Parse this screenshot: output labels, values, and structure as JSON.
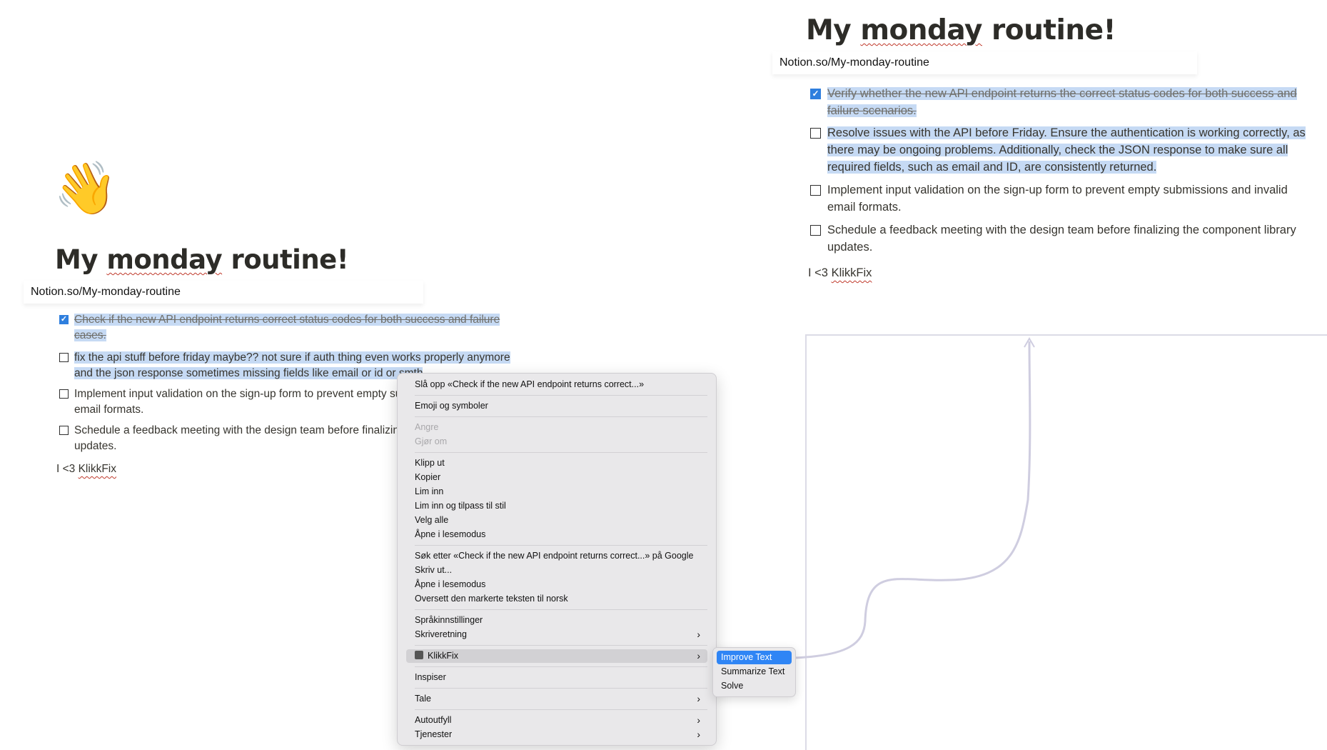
{
  "left_page": {
    "emoji": "👋",
    "title_prefix": "My ",
    "title_misspelled": "monday",
    "title_suffix": " routine!",
    "url": "Notion.so/My-monday-routine",
    "tasks": [
      {
        "checked": true,
        "lines": [
          "Check if the new API endpoint returns correct status codes for both success and failure",
          "cases."
        ]
      },
      {
        "checked": false,
        "lines": [
          "fix the api stuff before friday maybe?? not sure if auth thing even works properly anymore",
          "and the json response sometimes missing fields like email or id or smth"
        ]
      },
      {
        "checked": false,
        "lines": [
          "Implement input validation on the sign-up form to prevent empty sub",
          "email formats."
        ]
      },
      {
        "checked": false,
        "lines": [
          "Schedule a feedback meeting with the design team before finalizing",
          "updates."
        ]
      }
    ],
    "footer_prefix": "I <3 ",
    "footer_brand": "KlikkFix"
  },
  "context_menu": {
    "lookup": "Slå opp «Check if the new API endpoint returns correct...»",
    "emoji": "Emoji og symboler",
    "undo": "Angre",
    "redo": "Gjør om",
    "cut": "Klipp ut",
    "copy": "Kopier",
    "paste": "Lim inn",
    "paste_style": "Lim inn og tilpass til stil",
    "select_all": "Velg alle",
    "reader1": "Åpne i lesemodus",
    "search_google": "Søk etter «Check if the new API endpoint returns correct...» på Google",
    "print": "Skriv ut...",
    "reader2": "Åpne i lesemodus",
    "translate": "Oversett den markerte teksten til norsk",
    "language": "Språkinnstillinger",
    "writing_direction": "Skriveretning",
    "klikkfix": "KlikkFix",
    "inspect": "Inspiser",
    "speech": "Tale",
    "autofill": "Autoutfyll",
    "services": "Tjenester"
  },
  "submenu": {
    "items": [
      "Improve Text",
      "Summarize Text",
      "Solve"
    ]
  },
  "right_page": {
    "title_prefix": "My ",
    "title_misspelled": "monday",
    "title_suffix": " routine!",
    "url": "Notion.so/My-monday-routine",
    "tasks": [
      {
        "checked": true,
        "lines": [
          "Verify whether the new API endpoint returns the correct status codes for both success and",
          "failure scenarios."
        ]
      },
      {
        "checked": false,
        "lines": [
          "Resolve issues with the API before Friday. Ensure the authentication is working correctly, as",
          "there may be ongoing problems. Additionally, check the JSON response to make sure all",
          "required fields, such as email and ID, are consistently returned."
        ]
      },
      {
        "checked": false,
        "lines": [
          "Implement input validation on the sign-up form to prevent empty submissions and invalid",
          "email formats."
        ]
      },
      {
        "checked": false,
        "lines": [
          "Schedule a feedback meeting with the design team before finalizing the component library",
          "updates."
        ]
      }
    ],
    "footer_prefix": "I <3 ",
    "footer_brand": "KlikkFix"
  },
  "colors": {
    "selection": "#c6daf4",
    "checkbox": "#2f7fde",
    "menu_bg": "#e9e8ea",
    "submenu_active": "#2f85f5"
  }
}
